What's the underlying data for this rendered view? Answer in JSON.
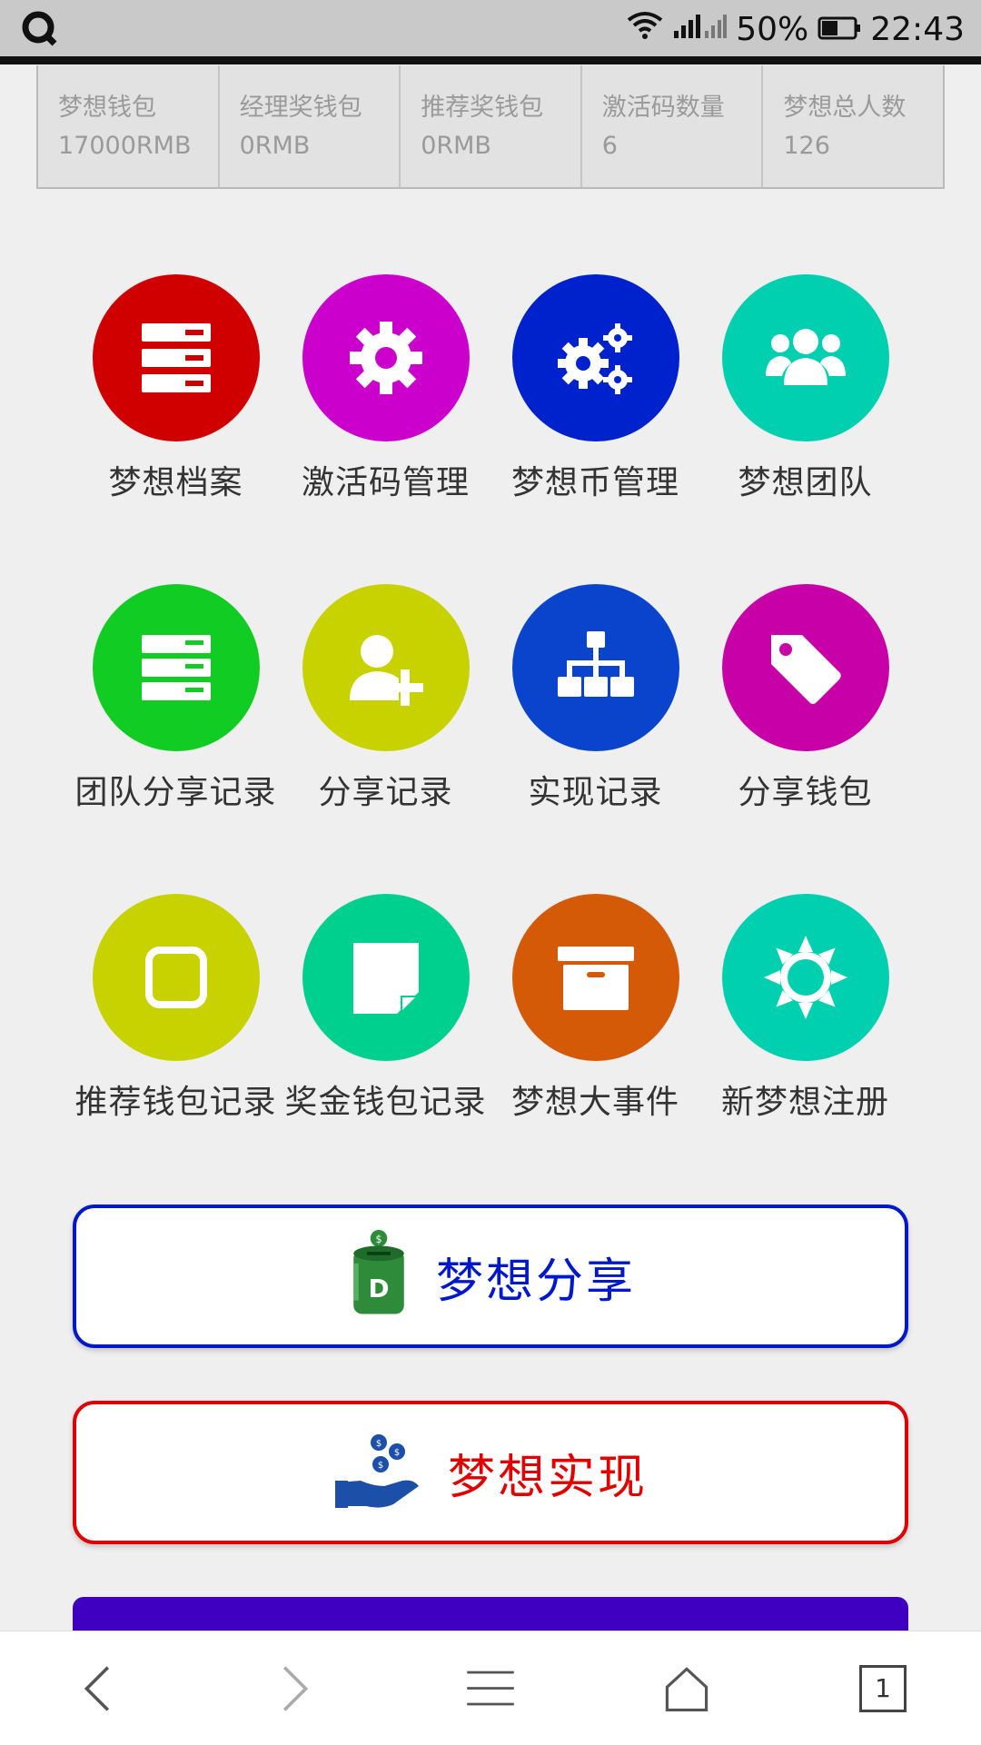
{
  "status_bar": {
    "battery_percent": "50%",
    "time": "22:43"
  },
  "stats": [
    {
      "label": "梦想钱包",
      "value": "17000RMB"
    },
    {
      "label": "经理奖钱包",
      "value": "0RMB"
    },
    {
      "label": "推荐奖钱包",
      "value": "0RMB"
    },
    {
      "label": "激活码数量",
      "value": "6"
    },
    {
      "label": "梦想总人数",
      "value": "126"
    }
  ],
  "menu": [
    {
      "label": "梦想档案",
      "icon": "server-icon",
      "color": "#d10000"
    },
    {
      "label": "激活码管理",
      "icon": "gear-icon",
      "color": "#cc00cc"
    },
    {
      "label": "梦想币管理",
      "icon": "gears-icon",
      "color": "#0022cc"
    },
    {
      "label": "梦想团队",
      "icon": "users-icon",
      "color": "#00d0b0"
    },
    {
      "label": "团队分享记录",
      "icon": "list-icon",
      "color": "#11cc22"
    },
    {
      "label": "分享记录",
      "icon": "user-plus-icon",
      "color": "#c8d200"
    },
    {
      "label": "实现记录",
      "icon": "sitemap-icon",
      "color": "#0a44cc"
    },
    {
      "label": "分享钱包",
      "icon": "tag-icon",
      "color": "#c800a8"
    },
    {
      "label": "推荐钱包记录",
      "icon": "square-icon",
      "color": "#c8d200"
    },
    {
      "label": "奖金钱包记录",
      "icon": "note-icon",
      "color": "#00d08e"
    },
    {
      "label": "梦想大事件",
      "icon": "archive-icon",
      "color": "#d45a08"
    },
    {
      "label": "新梦想注册",
      "icon": "sun-icon",
      "color": "#00d0b0"
    }
  ],
  "buttons": {
    "share": {
      "label": "梦想分享",
      "color": "#0018cc",
      "icon": "piggy-bank-icon"
    },
    "realize": {
      "label": "梦想实现",
      "color": "#e00000",
      "icon": "coins-hand-icon"
    }
  },
  "nav": {
    "tab_count": "1"
  }
}
